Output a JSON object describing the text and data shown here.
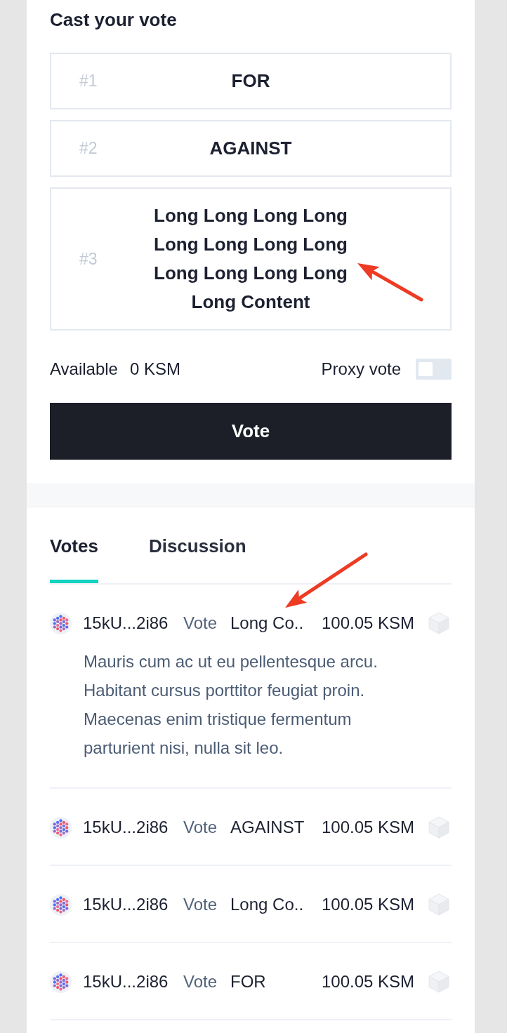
{
  "vote_panel": {
    "title": "Cast your vote",
    "options": [
      {
        "number": "#1",
        "label": "FOR",
        "selected": false
      },
      {
        "number": "#2",
        "label": "AGAINST",
        "selected": false
      },
      {
        "number": "#3",
        "label": "Long Long Long Long Long Long Long Long Long Long Long Long Long Content",
        "selected": false
      }
    ],
    "available_label": "Available",
    "available_value": "0 KSM",
    "proxy_vote": {
      "label": "Proxy vote",
      "on": false
    },
    "submit_button": "Vote"
  },
  "tabs": [
    {
      "label": "Votes",
      "selected": true
    },
    {
      "label": "Discussion",
      "selected": false
    }
  ],
  "votes": [
    {
      "address": "15kU...2i86",
      "action": "Vote",
      "choice": "Long Co..",
      "amount": "100.05 KSM",
      "comment": "Mauris cum ac ut eu pellentesque arcu. Habitant cursus porttitor feugiat proin. Maecenas enim tristique fermentum parturient nisi, nulla sit leo."
    },
    {
      "address": "15kU...2i86",
      "action": "Vote",
      "choice": "AGAINST",
      "amount": "100.05 KSM"
    },
    {
      "address": "15kU...2i86",
      "action": "Vote",
      "choice": "Long Co..",
      "amount": "100.05 KSM"
    },
    {
      "address": "15kU...2i86",
      "action": "Vote",
      "choice": "FOR",
      "amount": "100.05 KSM"
    }
  ]
}
